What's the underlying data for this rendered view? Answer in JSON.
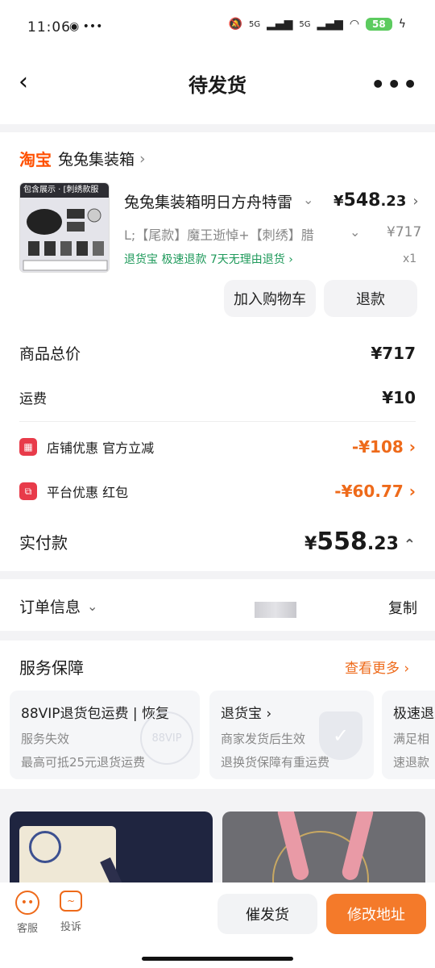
{
  "status_bar": {
    "time": "11:06",
    "signal1": "5G",
    "signal2": "5G",
    "battery": "58"
  },
  "nav": {
    "title": "待发货"
  },
  "store": {
    "platform": "淘宝",
    "name": "兔兔集装箱"
  },
  "product": {
    "thumb_header": "包含展示 · [刺绣款服封]",
    "title": "兔兔集装箱明日方舟特雷",
    "price_symbol": "¥",
    "price_int": "548",
    "price_dec": ".23",
    "spec": "L;【尾款】魔王逝悼+【刺绣】腊",
    "orig_price": "¥717",
    "service_tags": "退货宝 极速退款 7天无理由退货",
    "qty": "x1",
    "btn_cart": "加入购物车",
    "btn_refund": "退款"
  },
  "summary": {
    "total_label": "商品总价",
    "total_value": "¥717",
    "shipping_label": "运费",
    "shipping_value": "¥10",
    "store_coupon_label": "店铺优惠 官方立减",
    "store_coupon_value": "-¥108",
    "platform_coupon_label": "平台优惠 红包",
    "platform_coupon_value": "-¥60.77",
    "paid_label": "实付款",
    "paid_symbol": "¥",
    "paid_int": "558",
    "paid_dec": ".23"
  },
  "order_info": {
    "label": "订单信息",
    "copy": "复制"
  },
  "service": {
    "title": "服务保障",
    "more": "查看更多",
    "cards": [
      {
        "title": "88VIP退货包运费 | 恢复",
        "line1": "服务失效",
        "line2": "最高可抵25元退货运费",
        "badge": "88VIP"
      },
      {
        "title": "退货宝",
        "line1": "商家发货后生效",
        "line2": "退换货保障有重运费"
      },
      {
        "title": "极速退",
        "line1": "满足相",
        "line2": "速退款"
      }
    ]
  },
  "bottom": {
    "service_label": "客服",
    "complain_label": "投诉",
    "remind_btn": "催发货",
    "modify_btn": "修改地址"
  },
  "colors": {
    "orange": "#ee6a1a",
    "taobao": "#ff5000",
    "green": "#1f9a5b",
    "accent_btn": "#f47a2a"
  }
}
